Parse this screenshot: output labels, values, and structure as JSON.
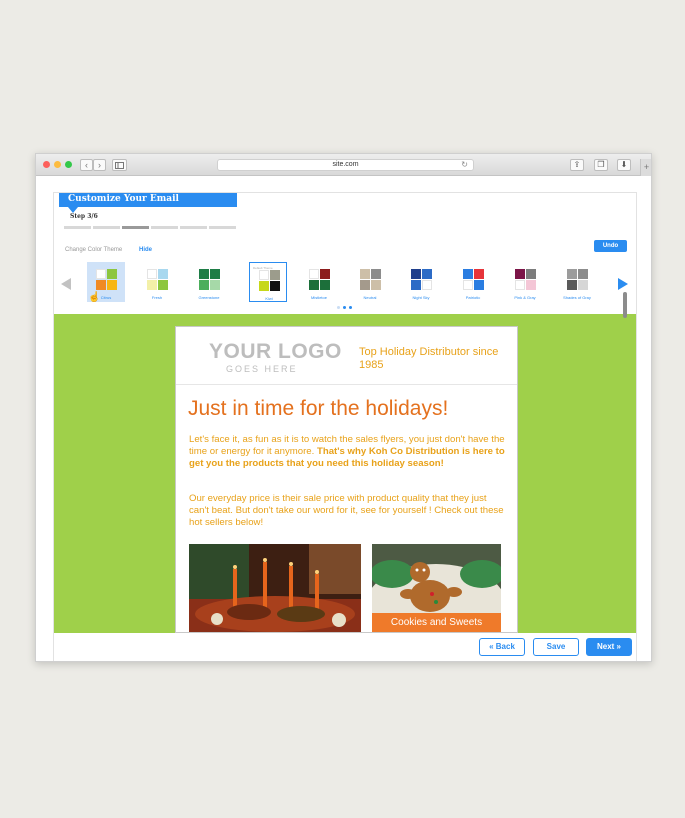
{
  "browser": {
    "url": "site.com",
    "traffic_colors": [
      "#fc605c",
      "#fdbc40",
      "#34c84a"
    ],
    "back_icon": "chevron-left-icon",
    "forward_icon": "chevron-right-icon",
    "sidebar_icon": "sidebar-icon",
    "reload_icon": "reload-icon",
    "share_icon": "share-icon",
    "tabs_icon": "tabs-icon",
    "download_icon": "download-icon",
    "new_tab": "+"
  },
  "wizard": {
    "banner_title": "Customize Your Email",
    "step_label": "Step 3/6",
    "steps_total": 6,
    "current_step": 3
  },
  "theme_picker": {
    "label": "Change Color Theme",
    "hide_label": "Hide",
    "undo_label": "Undo",
    "selected": "Citrus",
    "page_count": 3,
    "current_page": 2,
    "mini_label": "Default Theme",
    "themes": [
      {
        "name": "Citrus",
        "colors": [
          "#ffffff",
          "#8dc63f",
          "#f08a24",
          "#f7b614"
        ]
      },
      {
        "name": "Fresh",
        "colors": [
          "#ffffff",
          "#a8d8ef",
          "#f3f0a8",
          "#8dc63f"
        ]
      },
      {
        "name": "Greenstone",
        "colors": [
          "#1e7d46",
          "#1e7d46",
          "#4cae5c",
          "#a6d9a8"
        ]
      },
      {
        "name": "Kiwi",
        "colors": [
          "#ffffff",
          "#9c9c8c",
          "#c6d81a",
          "#111111"
        ]
      },
      {
        "name": "Mistletoe",
        "colors": [
          "#ffffff",
          "#8c1c1c",
          "#1c6f3a",
          "#1c6f3a"
        ]
      },
      {
        "name": "Neutral",
        "colors": [
          "#cdbfa8",
          "#8c8c8c",
          "#a49a8c",
          "#cdbfa8"
        ]
      },
      {
        "name": "Night Sky",
        "colors": [
          "#1f3f8c",
          "#2c6bc6",
          "#2c6bc6",
          "#ffffff"
        ]
      },
      {
        "name": "Patriotic",
        "colors": [
          "#2a7de1",
          "#e6343a",
          "#ffffff",
          "#2a7de1"
        ]
      },
      {
        "name": "Pink & Gray",
        "colors": [
          "#7c1548",
          "#7c7c7c",
          "#ffffff",
          "#f4c6d6"
        ]
      },
      {
        "name": "Shades of Gray",
        "colors": [
          "#9c9c9c",
          "#8c8c8c",
          "#5a5a5a",
          "#d6d6d6"
        ]
      }
    ]
  },
  "email": {
    "logo_main": "YOUR LOGO",
    "logo_sub": "GOES HERE",
    "tagline": "Top Holiday Distributor since 1985",
    "headline": "Just in time for the holidays!",
    "para1_plain": "Let's face it, as fun as it is to watch the sales flyers, you just don't have the time or energy for it anymore. ",
    "para1_bold": "That's why Koh Co Distribution is here to get you the products that you need this holiday season!",
    "para2": "Our everyday price is their sale price with product quality that they just can't beat. But don't take our word for it, see for yourself ! Check out these hot sellers below!",
    "product_label": "Cookies and Sweets",
    "colors": {
      "background": "#9fd04a",
      "headline": "#e4711e",
      "body": "#e8a21a",
      "accent": "#ef7a2a"
    }
  },
  "footer": {
    "back_label": "« Back",
    "save_label": "Save",
    "next_label": "Next »"
  }
}
